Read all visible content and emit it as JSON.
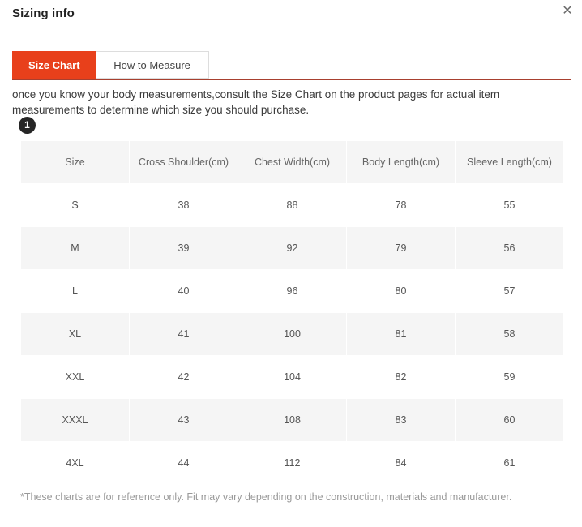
{
  "modal": {
    "title": "Sizing info",
    "close_icon": "close-icon",
    "close_glyph": "✕"
  },
  "tabs": [
    {
      "label": "Size Chart",
      "active": true
    },
    {
      "label": "How to Measure",
      "active": false
    }
  ],
  "description": "once you know your body measurements,consult the Size Chart on the product pages for actual item measurements to determine which size you should purchase.",
  "step_badge": "1",
  "table": {
    "headers": [
      "Size",
      "Cross Shoulder(cm)",
      "Chest Width(cm)",
      "Body Length(cm)",
      "Sleeve Length(cm)"
    ],
    "rows": [
      [
        "S",
        "38",
        "88",
        "78",
        "55"
      ],
      [
        "M",
        "39",
        "92",
        "79",
        "56"
      ],
      [
        "L",
        "40",
        "96",
        "80",
        "57"
      ],
      [
        "XL",
        "41",
        "100",
        "81",
        "58"
      ],
      [
        "XXL",
        "42",
        "104",
        "82",
        "59"
      ],
      [
        "XXXL",
        "43",
        "108",
        "83",
        "60"
      ],
      [
        "4XL",
        "44",
        "112",
        "84",
        "61"
      ]
    ]
  },
  "footnote": "*These charts are for reference only. Fit may vary depending on the construction, materials and manufacturer.",
  "colors": {
    "accent": "#e8401b",
    "underline": "#a8402f",
    "row_shade": "#f5f5f5",
    "badge": "#262626",
    "text": "#3a3a3a",
    "muted": "#999999"
  }
}
